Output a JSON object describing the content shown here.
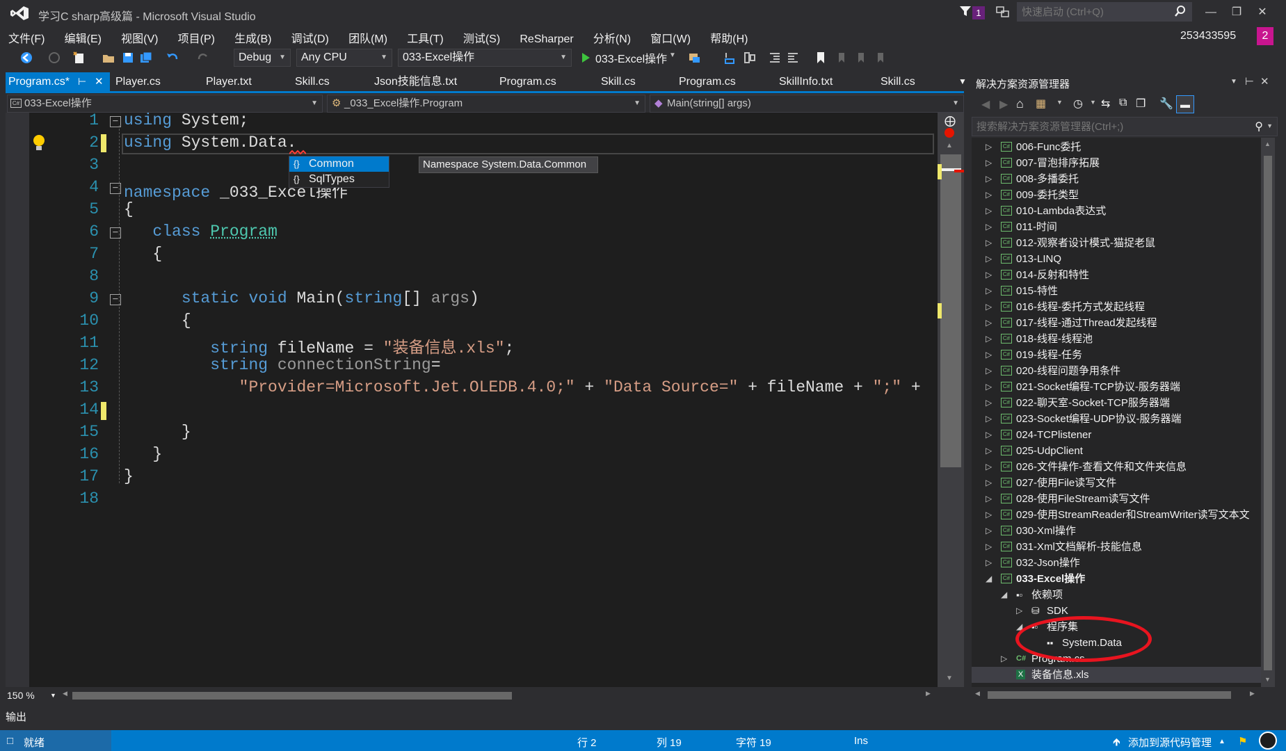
{
  "window": {
    "title": "学习C sharp高级篇 - Microsoft Visual Studio",
    "notification_count": "1",
    "quick_launch_placeholder": "快速启动 (Ctrl+Q)",
    "user_id": "253433595",
    "user_badge": "2"
  },
  "menu": [
    "文件(F)",
    "编辑(E)",
    "视图(V)",
    "项目(P)",
    "生成(B)",
    "调试(D)",
    "团队(M)",
    "工具(T)",
    "测试(S)",
    "ReSharper",
    "分析(N)",
    "窗口(W)",
    "帮助(H)"
  ],
  "toolbar": {
    "config": "Debug",
    "platform": "Any CPU",
    "startup_project": "033-Excel操作",
    "run_label": "033-Excel操作"
  },
  "tabs": [
    "Program.cs*",
    "Player.cs",
    "Player.txt",
    "Skill.cs",
    "Json技能信息.txt",
    "Program.cs",
    "Skill.cs",
    "Program.cs",
    "SkillInfo.txt",
    "Skill.cs"
  ],
  "navbar": {
    "project": "033-Excel操作",
    "class": "_033_Excel操作.Program",
    "member": "Main(string[] args)"
  },
  "code": {
    "line_numbers": [
      "1",
      "2",
      "3",
      "4",
      "5",
      "6",
      "7",
      "8",
      "9",
      "10",
      "11",
      "12",
      "13",
      "14",
      "15",
      "16",
      "17",
      "18"
    ],
    "l1_kw": "using",
    "l1_rest": " System;",
    "l2_kw": "using",
    "l2_rest": " System.Data.",
    "l4_kw": "namespace",
    "l4_rest": " _033_Excel操作",
    "l5": "{",
    "l6_kw": "class",
    "l6_type": "Program",
    "l7": "{",
    "l9_kw1": "static",
    "l9_kw2": "void",
    "l9_name": "Main(",
    "l9_kw3": "string",
    "l9_rest": "[] ",
    "l9_arg": "args",
    "l9_close": ")",
    "l10": "{",
    "l11_kw": "string",
    "l11_name": "fileName",
    "l11_eq": " = ",
    "l11_str": "\"装备信息.xls\"",
    "l11_end": ";",
    "l12_kw": "string",
    "l12_name": "connectionString",
    "l12_eq": "=",
    "l13_s1": "\"Provider=Microsoft.Jet.OLEDB.4.0;\"",
    "l13_p1": " + ",
    "l13_s2": "\"Data Source=\"",
    "l13_p2": " + fileName + ",
    "l13_s3": "\";\"",
    "l13_p3": " +",
    "l15": "}",
    "l16": "}",
    "l17": "}"
  },
  "intellisense": {
    "items": [
      "Common",
      "SqlTypes"
    ],
    "tooltip": "Namespace System.Data.Common"
  },
  "editor": {
    "zoom": "150 %"
  },
  "solution_explorer": {
    "title": "解决方案资源管理器",
    "search_placeholder": "搜索解决方案资源管理器(Ctrl+;)",
    "items": [
      "006-Func委托",
      "007-冒泡排序拓展",
      "008-多播委托",
      "009-委托类型",
      "010-Lambda表达式",
      "011-时间",
      "012-观察者设计模式-猫捉老鼠",
      "013-LINQ",
      "014-反射和特性",
      "015-特性",
      "016-线程-委托方式发起线程",
      "017-线程-通过Thread发起线程",
      "018-线程-线程池",
      "019-线程-任务",
      "020-线程问题争用条件",
      "021-Socket编程-TCP协议-服务器端",
      "022-聊天室-Socket-TCP服务器端",
      "023-Socket编程-UDP协议-服务器端",
      "024-TCPlistener",
      "025-UdpClient",
      "026-文件操作-查看文件和文件夹信息",
      "027-使用File读写文件",
      "028-使用FileStream读写文件",
      "029-使用StreamReader和StreamWriter读写文本文",
      "030-Xml操作",
      "031-Xml文档解析-技能信息",
      "032-Json操作"
    ],
    "current_project": "033-Excel操作",
    "dependencies": "依赖项",
    "sdk": "SDK",
    "assemblies": "程序集",
    "system_data": "System.Data",
    "program_file": "Program.cs",
    "excel_file": "装备信息.xls"
  },
  "output_label": "输出",
  "status": {
    "ready": "就绪",
    "line": "行 2",
    "col": "列 19",
    "char": "字符 19",
    "ins": "Ins",
    "source_control": "添加到源代码管理"
  },
  "colors": {
    "accent": "#007acc",
    "keyword": "#569cd6",
    "type": "#4ec9b0",
    "string": "#d69d85",
    "line_number": "#2b91af",
    "annotation": "#e8141f"
  }
}
